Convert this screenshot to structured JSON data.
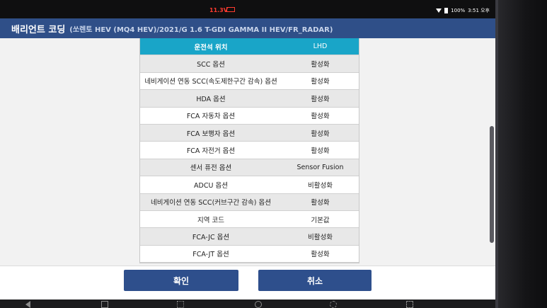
{
  "status": {
    "voltage": "11.3V",
    "battery_percent": "100%",
    "time": "3:51 오후"
  },
  "header": {
    "title": "배리언트 코딩",
    "subtitle": "(쏘렌토 HEV (MQ4 HEV)/2021/G 1.6 T-GDI GAMMA II HEV/FR_RADAR)"
  },
  "table": {
    "header": {
      "name": "운전석 위치",
      "value": "LHD"
    },
    "rows": [
      {
        "name": "SCC 옵션",
        "value": "활성화"
      },
      {
        "name": "네비게이션 연동 SCC(속도제한구간 감속) 옵션",
        "value": "활성화"
      },
      {
        "name": "HDA 옵션",
        "value": "활성화"
      },
      {
        "name": "FCA 자동차 옵션",
        "value": "활성화"
      },
      {
        "name": "FCA 보행자 옵션",
        "value": "활성화"
      },
      {
        "name": "FCA 자전거 옵션",
        "value": "활성화"
      },
      {
        "name": "센서 퓨전 옵션",
        "value": "Sensor Fusion"
      },
      {
        "name": "ADCU 옵션",
        "value": "비활성화"
      },
      {
        "name": "네비게이션 연동 SCC(커브구간 감속) 옵션",
        "value": "활성화"
      },
      {
        "name": "지역 코드",
        "value": "기본값"
      },
      {
        "name": "FCA-JC 옵션",
        "value": "비활성화"
      },
      {
        "name": "FCA-JT 옵션",
        "value": "활성화"
      }
    ]
  },
  "buttons": {
    "ok": "확인",
    "cancel": "취소"
  },
  "colors": {
    "header_bg": "#2f4f88",
    "table_head": "#19a5c8",
    "button": "#2e4f8c",
    "voltage_warning": "#ff3b2f"
  }
}
